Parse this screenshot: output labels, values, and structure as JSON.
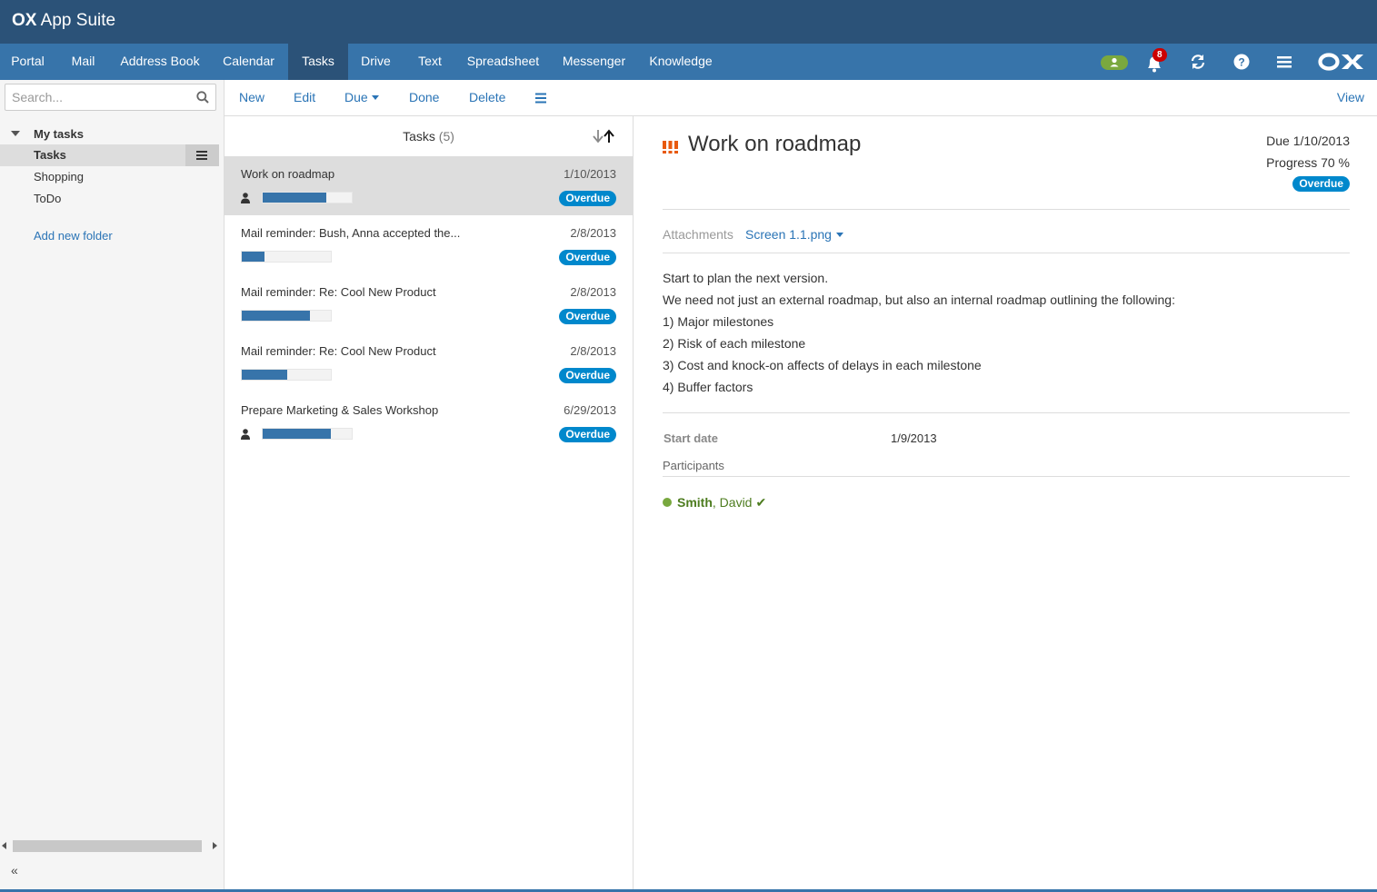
{
  "app": {
    "title_bold": "OX",
    "title_rest": " App Suite"
  },
  "nav": {
    "tabs": [
      {
        "label": "Portal"
      },
      {
        "label": "Mail"
      },
      {
        "label": "Address Book"
      },
      {
        "label": "Calendar"
      },
      {
        "label": "Tasks"
      },
      {
        "label": "Drive"
      },
      {
        "label": "Text"
      },
      {
        "label": "Spreadsheet"
      },
      {
        "label": "Messenger"
      },
      {
        "label": "Knowledge"
      }
    ],
    "active_tab": "Tasks",
    "notification_count": "8",
    "icons": [
      "presence-icon",
      "bell-icon",
      "refresh-icon",
      "help-icon",
      "menu-icon",
      "ox-logo"
    ]
  },
  "sidebar": {
    "search_placeholder": "Search...",
    "tree_root": "My tasks",
    "folders": [
      {
        "label": "Tasks"
      },
      {
        "label": "Shopping"
      },
      {
        "label": "ToDo"
      }
    ],
    "selected_folder": "Tasks",
    "add_folder": "Add new folder",
    "collapse": "«"
  },
  "toolbar": {
    "new": "New",
    "edit": "Edit",
    "due": "Due",
    "done": "Done",
    "delete": "Delete",
    "view": "View"
  },
  "list": {
    "heading": "Tasks",
    "count": "(5)",
    "items": [
      {
        "title": "Work on roadmap",
        "date": "1/10/2013",
        "progress": 0.7,
        "has_participants": true,
        "status": "Overdue"
      },
      {
        "title": "Mail reminder: Bush, Anna accepted the...",
        "date": "2/8/2013",
        "progress": 0.25,
        "has_participants": false,
        "status": "Overdue"
      },
      {
        "title": "Mail reminder: Re: Cool New Product",
        "date": "2/8/2013",
        "progress": 0.75,
        "has_participants": false,
        "status": "Overdue"
      },
      {
        "title": "Mail reminder: Re: Cool New Product",
        "date": "2/8/2013",
        "progress": 0.5,
        "has_participants": false,
        "status": "Overdue"
      },
      {
        "title": "Prepare Marketing & Sales Workshop",
        "date": "6/29/2013",
        "progress": 0.75,
        "has_participants": true,
        "status": "Overdue"
      }
    ]
  },
  "detail": {
    "title": "Work on roadmap",
    "due": "Due 1/10/2013",
    "progress": "Progress 70 %",
    "status": "Overdue",
    "attachments_label": "Attachments",
    "attachment": "Screen 1.1.png",
    "note": [
      "Start to plan the next version.",
      "We need not just an external roadmap, but also an internal roadmap outlining the following:",
      "1) Major milestones",
      "2) Risk of each milestone",
      "3) Cost and knock-on affects of delays in each milestone",
      "4) Buffer factors"
    ],
    "start_date_label": "Start date",
    "start_date": "1/9/2013",
    "participants_label": "Participants",
    "participant": {
      "last": "Smith",
      "first": ", David"
    }
  },
  "colors": {
    "banner": "#2b5278",
    "nav": "#3774aa",
    "link": "#2a74b6",
    "badge": "#0088cc",
    "priority": "#ee5500"
  }
}
